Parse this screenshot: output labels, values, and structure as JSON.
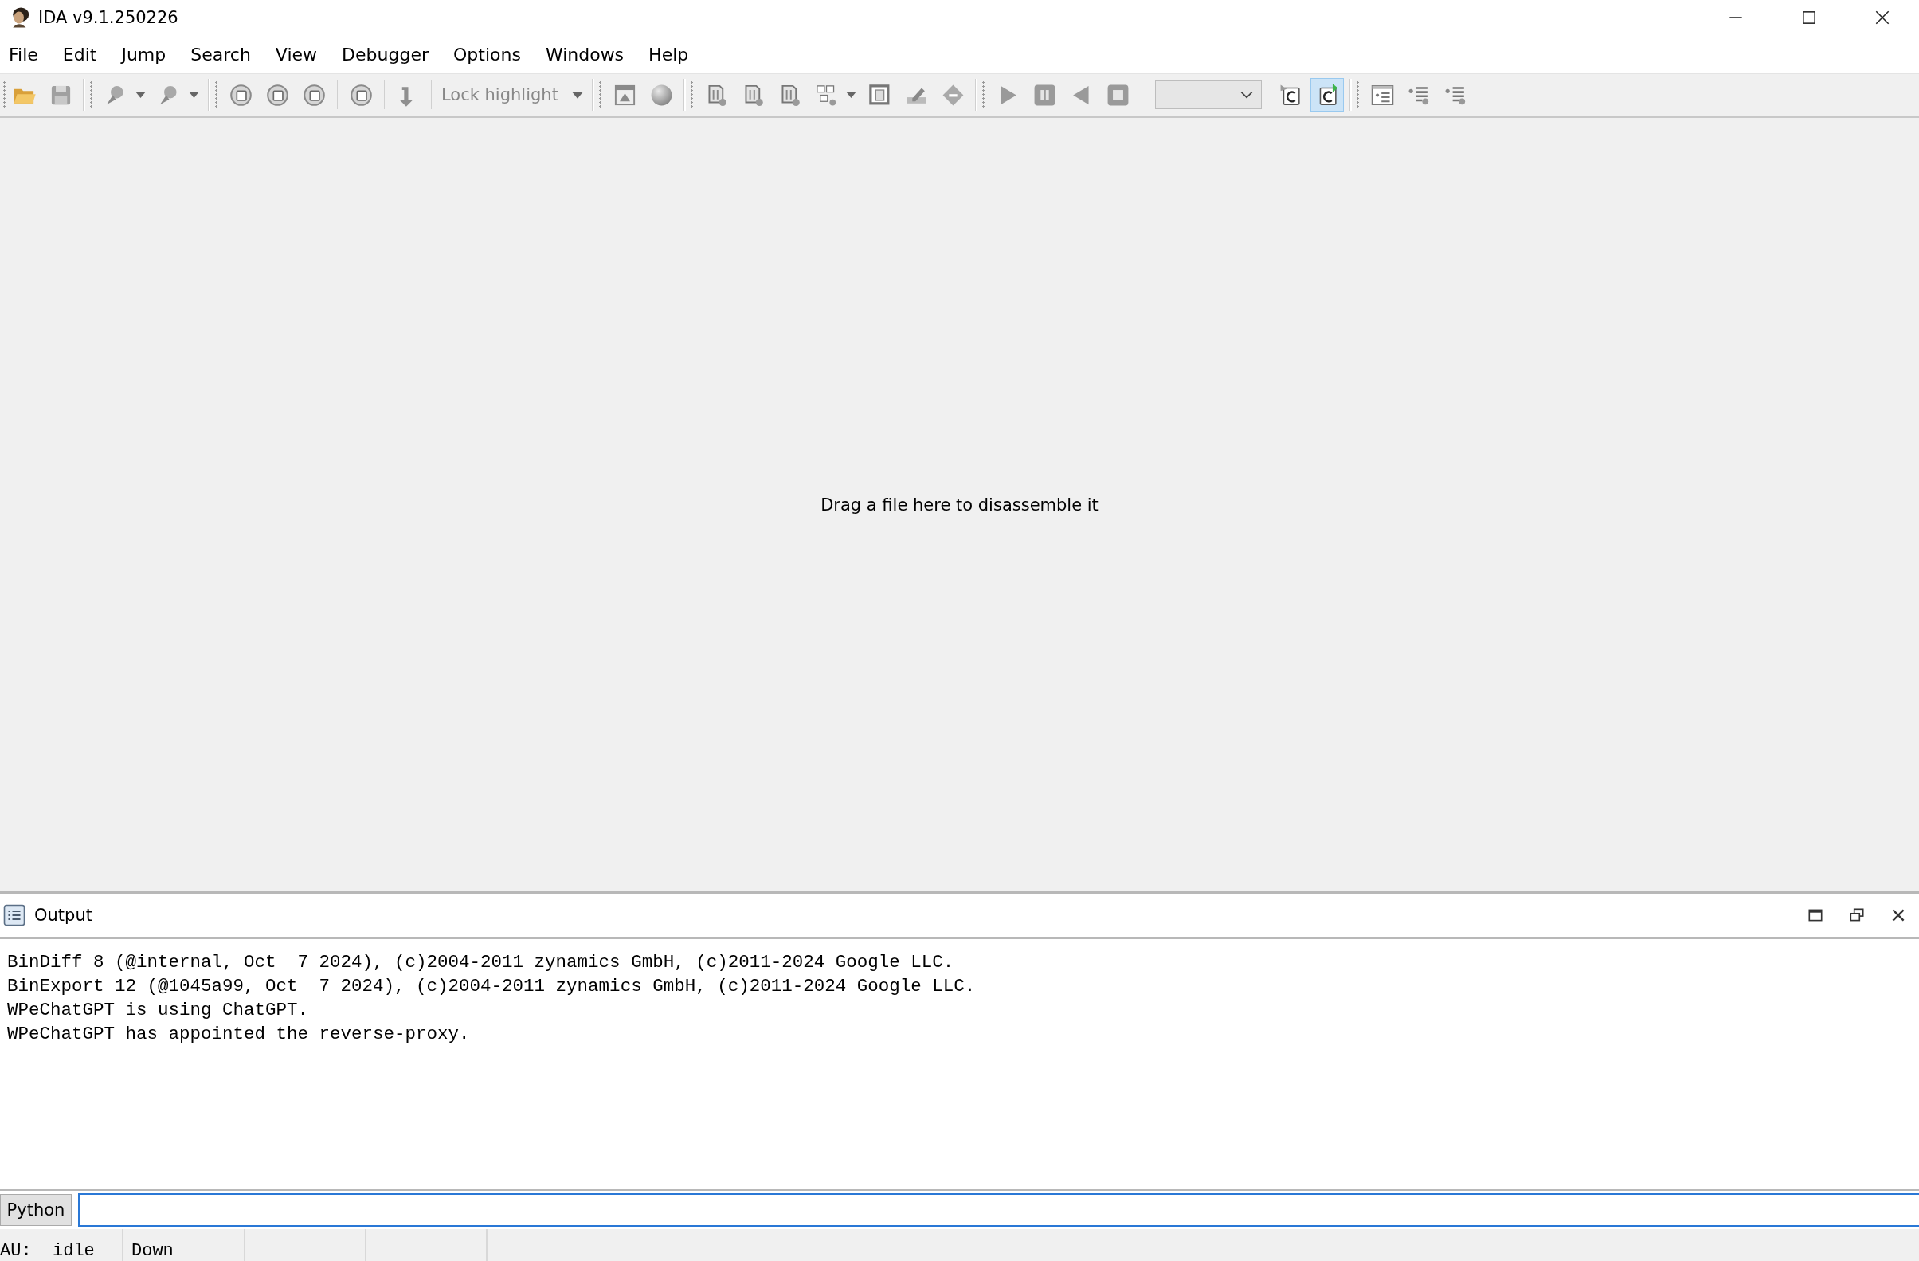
{
  "window": {
    "title": "IDA v9.1.250226"
  },
  "menu": [
    "File",
    "Edit",
    "Jump",
    "Search",
    "View",
    "Debugger",
    "Options",
    "Windows",
    "Help"
  ],
  "toolbar": {
    "lock_highlight": "Lock highlight",
    "toggles": [
      {
        "selected": false
      },
      {
        "selected": true
      }
    ]
  },
  "main": {
    "hint": "Drag a file here to disassemble it"
  },
  "output": {
    "title": "Output",
    "lines": [
      "BinDiff 8 (@internal, Oct  7 2024), (c)2004-2011 zynamics GmbH, (c)2011-2024 Google LLC.",
      "BinExport 12 (@1045a99, Oct  7 2024), (c)2004-2011 zynamics GmbH, (c)2011-2024 Google LLC.",
      "WPeChatGPT is using ChatGPT.",
      "WPeChatGPT has appointed the reverse-proxy."
    ]
  },
  "command_line": {
    "language": "Python"
  },
  "status_bar": [
    "AU:  idle",
    "Down"
  ]
}
